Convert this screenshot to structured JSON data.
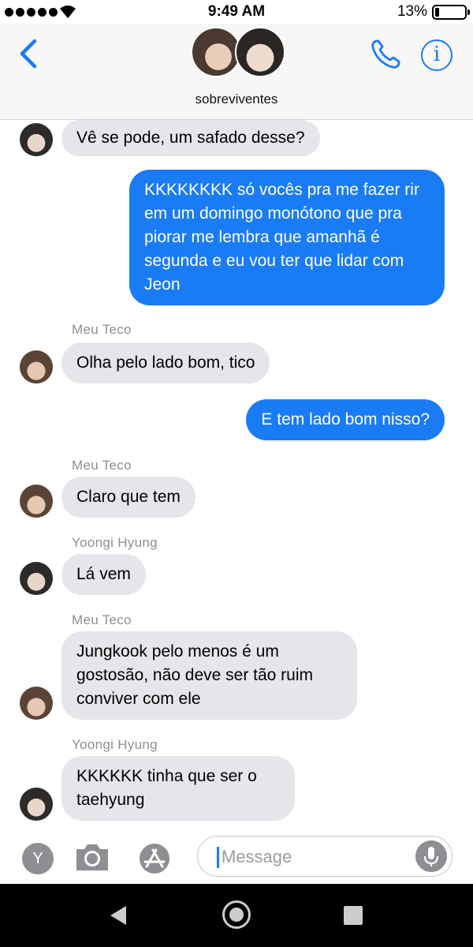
{
  "status_bar": {
    "time": "9:49 AM",
    "battery_percent": "13%",
    "battery_level": 0.13,
    "signal_dots": 5
  },
  "header": {
    "group_name": "sobreviventes",
    "back_icon": "chevron-left-icon",
    "call_icon": "phone-icon",
    "info_icon": "info-icon",
    "info_label": "i",
    "accent_color": "#1a7cf5"
  },
  "messages": [
    {
      "direction": "incoming",
      "text": "Vê se pode, um safado desse?"
    },
    {
      "direction": "outgoing",
      "text": "KKKKKKKK só vocês pra me fazer rir em um domingo monótono que pra piorar me lembra que amanhã é segunda e eu vou ter que lidar com Jeon"
    },
    {
      "direction": "incoming",
      "sender": "Meu Teco",
      "text": "Olha pelo lado bom, tico"
    },
    {
      "direction": "outgoing",
      "text": "E tem lado bom nisso?"
    },
    {
      "direction": "incoming",
      "sender": "Meu Teco",
      "text": "Claro que tem"
    },
    {
      "direction": "incoming",
      "sender": "Yoongi Hyung",
      "text": "Lá vem"
    },
    {
      "direction": "incoming",
      "sender": "Meu Teco",
      "text": "Jungkook pelo menos é um gostosão, não deve ser tão ruim conviver com ele"
    },
    {
      "direction": "incoming",
      "sender": "Yoongi Hyung",
      "text": "KKKKKK tinha que ser o taehyung"
    }
  ],
  "input_bar": {
    "apps_label": "Y",
    "placeholder": "Message",
    "camera_icon": "camera-icon",
    "appstore_icon": "app-store-icon",
    "mic_icon": "microphone-icon"
  },
  "colors": {
    "outgoing_bubble": "#1a7cf5",
    "incoming_bubble": "#e5e5ea",
    "sender_label": "#8e8e93"
  }
}
